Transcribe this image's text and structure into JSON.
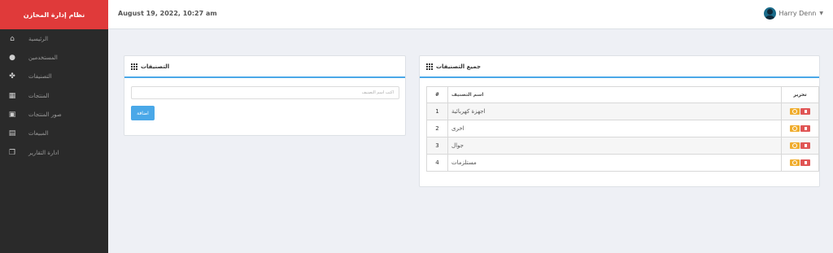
{
  "app": {
    "brand": "نظام إدارة المخازن"
  },
  "header": {
    "datetime": "August 19, 2022, 10:27 am",
    "user_name": "Harry Denn"
  },
  "sidebar": {
    "items": [
      {
        "label": "الرئيسية",
        "icon": "home-icon"
      },
      {
        "label": "المستخدمين",
        "icon": "user-icon"
      },
      {
        "label": "التصنيفات",
        "icon": "categories-icon"
      },
      {
        "label": "المنتجات",
        "icon": "products-icon"
      },
      {
        "label": "صور المنتجات",
        "icon": "image-icon"
      },
      {
        "label": "المبيعات",
        "icon": "sales-icon"
      },
      {
        "label": "ادارة التقارير",
        "icon": "reports-icon"
      }
    ]
  },
  "add_panel": {
    "title": "التصنيفات",
    "input_placeholder": "اكتب اسم التصنيف",
    "add_label": "اضافة"
  },
  "list_panel": {
    "title": "جميع التصنيفات",
    "columns": {
      "num": "#",
      "name": "اسم التصنيف",
      "actions": "تحرير"
    },
    "rows": [
      {
        "num": "1",
        "name": "اجهزة كهربائية"
      },
      {
        "num": "2",
        "name": "اخرى"
      },
      {
        "num": "3",
        "name": "جوال"
      },
      {
        "num": "4",
        "name": "مستلزمات"
      }
    ]
  }
}
